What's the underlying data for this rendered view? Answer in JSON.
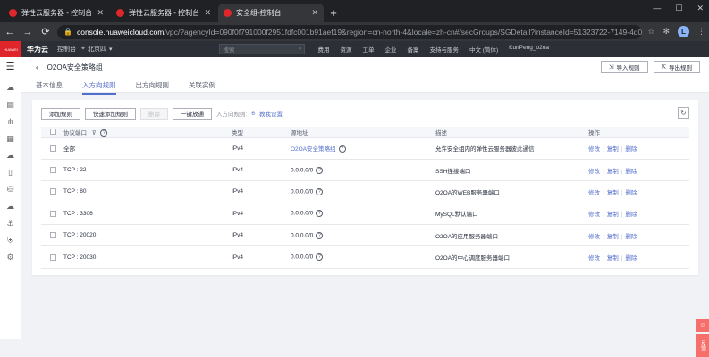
{
  "browser": {
    "tabs": [
      {
        "title": "弹性云服务器 - 控制台",
        "active": false
      },
      {
        "title": "弹性云服务器 - 控制台",
        "active": false
      },
      {
        "title": "安全组-控制台",
        "active": true
      }
    ],
    "url_domain": "console.huaweicloud.com",
    "url_path": "/vpc/?agencyId=090f0f791000f2951fdfc001b91aef19&region=cn-north-4&locale=zh-cn#/secGroups/SGDetail?instanceId=51323722-7149-4d05-a383-3ae963ac5...",
    "profile_initial": "L"
  },
  "header": {
    "logo_text": "HUAWEI",
    "brand": "华为云",
    "console": "控制台",
    "region": "北京四",
    "search_placeholder": "搜索",
    "links": [
      "费用",
      "资源",
      "工单",
      "企业",
      "备案",
      "支持与服务",
      "中文 (简体)",
      "KunPeng_o2oa"
    ]
  },
  "page": {
    "title": "O2OA安全策略组",
    "import_button": "导入规则",
    "export_button": "导出规则",
    "tabs": [
      {
        "label": "基本信息",
        "active": false
      },
      {
        "label": "入方向规则",
        "active": true
      },
      {
        "label": "出方向规则",
        "active": false
      },
      {
        "label": "关联实例",
        "active": false
      }
    ]
  },
  "actions": {
    "add_rule": "添加规则",
    "quick_add": "快速添加规则",
    "delete": "删除",
    "allow_all": "一键放通",
    "inbound_label": "入方向规则:",
    "inbound_count": "6",
    "tutorial_link": "教我设置"
  },
  "table": {
    "headers": [
      "协议端口",
      "类型",
      "源地址",
      "描述",
      "操作"
    ],
    "rows": [
      {
        "port": "全部",
        "type": "IPv4",
        "source": "O2OA安全策略组",
        "source_link": true,
        "desc": "允许安全组内的弹性云服务器彼此通信"
      },
      {
        "port": "TCP : 22",
        "type": "IPv4",
        "source": "0.0.0.0/0",
        "source_link": false,
        "desc": "SSH连接端口"
      },
      {
        "port": "TCP : 80",
        "type": "IPv4",
        "source": "0.0.0.0/0",
        "source_link": false,
        "desc": "O2OA的WEB服务器端口"
      },
      {
        "port": "TCP : 3306",
        "type": "IPv4",
        "source": "0.0.0.0/0",
        "source_link": false,
        "desc": "MySQL默认端口"
      },
      {
        "port": "TCP : 20020",
        "type": "IPv4",
        "source": "0.0.0.0/0",
        "source_link": false,
        "desc": "O2OA的应用服务器端口"
      },
      {
        "port": "TCP : 20030",
        "type": "IPv4",
        "source": "0.0.0.0/0",
        "source_link": false,
        "desc": "O2OA的中心调度服务器端口"
      }
    ],
    "ops": [
      "修改",
      "复制",
      "删除"
    ]
  },
  "feedback": [
    "☺",
    "反馈"
  ]
}
